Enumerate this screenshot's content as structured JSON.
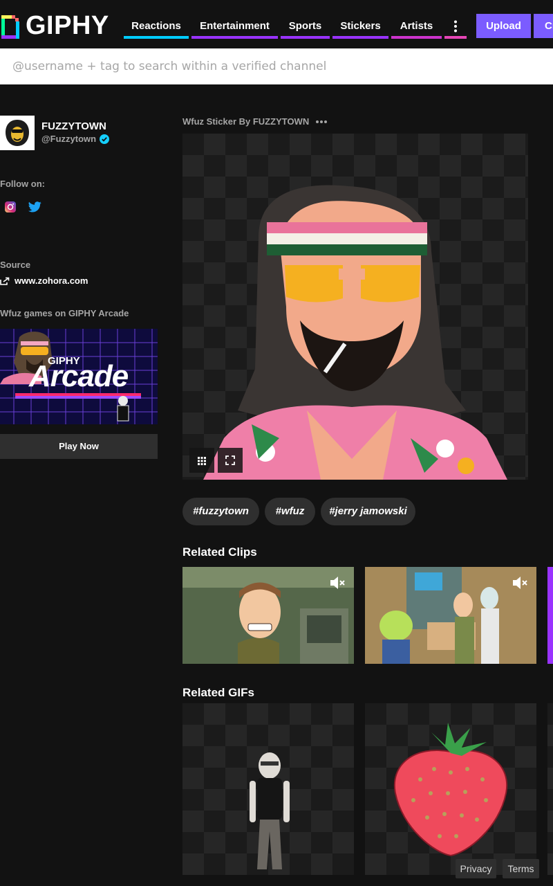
{
  "header": {
    "logo_text": "GIPHY",
    "nav": [
      {
        "label": "Reactions",
        "color": "#00ccff"
      },
      {
        "label": "Entertainment",
        "color": "#9933ff"
      },
      {
        "label": "Sports",
        "color": "#9933ff"
      },
      {
        "label": "Stickers",
        "color": "#9933ff"
      },
      {
        "label": "Artists",
        "color": "#cc33cc"
      }
    ],
    "more_icon": "vertical-dots-icon",
    "upload_label": "Upload",
    "create_label": "Cr"
  },
  "search": {
    "placeholder": "@username + tag to search within a verified channel"
  },
  "channel": {
    "name": "FUZZYTOWN",
    "handle": "@Fuzzytown",
    "follow_label": "Follow on:",
    "source_label": "Source",
    "source_link": "www.zohora.com",
    "arcade_label": "Wfuz games on GIPHY Arcade",
    "arcade_brand": "GIPHY",
    "arcade_title": "Arcade",
    "play_label": "Play Now"
  },
  "sticker": {
    "title": "Wfuz Sticker By FUZZYTOWN"
  },
  "tags": [
    "#fuzzytown",
    "#wfuz",
    "#jerry jamowski"
  ],
  "related_clips_title": "Related Clips",
  "related_gifs_title": "Related GIFs",
  "footer": {
    "privacy": "Privacy",
    "terms": "Terms"
  },
  "colors": {
    "accent": "#7b5cff",
    "verified": "#15cffd"
  }
}
